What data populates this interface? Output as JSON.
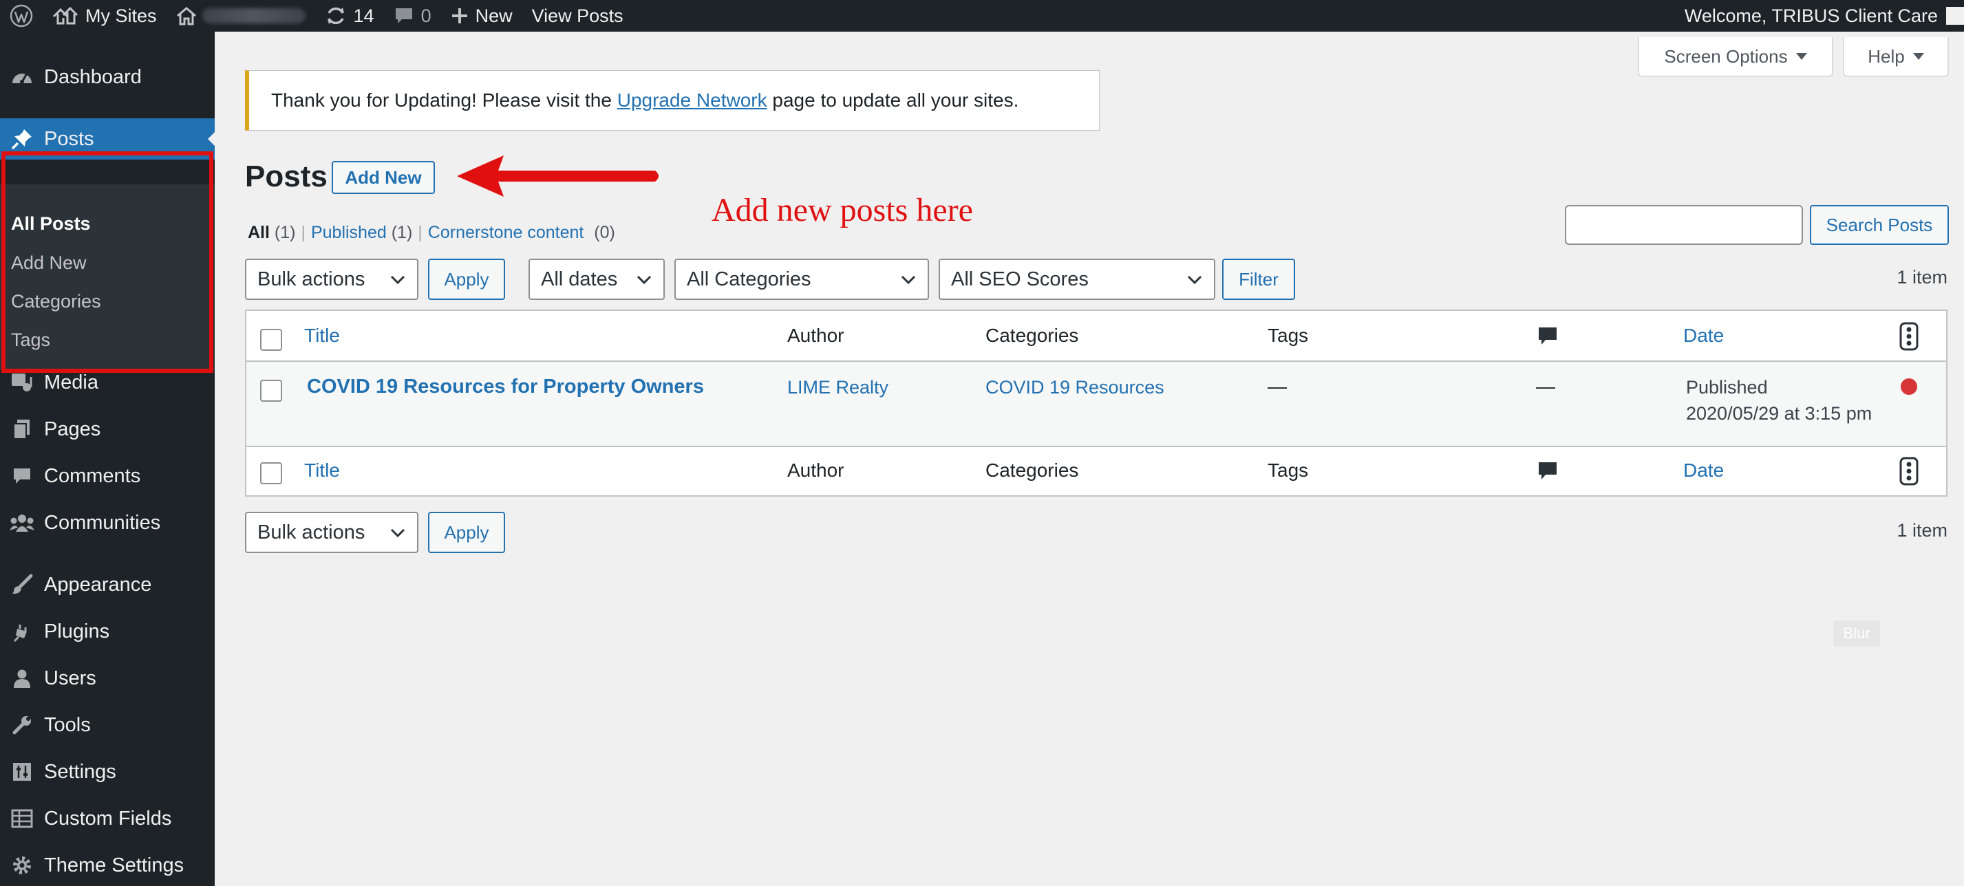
{
  "admin_bar": {
    "wp_logo": "wordpress-icon",
    "my_sites": "My Sites",
    "updates_count": "14",
    "comments_count": "0",
    "new_label": "New",
    "view_posts": "View Posts",
    "welcome": "Welcome, TRIBUS Client Care"
  },
  "sidebar": {
    "dashboard": "Dashboard",
    "posts": "Posts",
    "submenu": [
      "All Posts",
      "Add New",
      "Categories",
      "Tags"
    ],
    "media": "Media",
    "pages": "Pages",
    "comments": "Comments",
    "communities": "Communities",
    "appearance": "Appearance",
    "plugins": "Plugins",
    "users": "Users",
    "tools": "Tools",
    "settings": "Settings",
    "custom_fields": "Custom Fields",
    "theme_settings": "Theme Settings"
  },
  "screen_options": "Screen Options",
  "help": "Help",
  "notice": {
    "before": "Thank you for Updating! Please visit the ",
    "link": "Upgrade Network",
    "after": " page to update all your sites."
  },
  "page_title": "Posts",
  "add_new": "Add New",
  "annotation": "Add new posts here",
  "views": {
    "all": "All",
    "all_count": "(1)",
    "published": "Published",
    "published_count": "(1)",
    "cornerstone": "Cornerstone content",
    "cornerstone_count": "(0)"
  },
  "search": {
    "button": "Search Posts",
    "value": ""
  },
  "filters": {
    "bulk_actions": "Bulk actions",
    "apply": "Apply",
    "dates": "All dates",
    "categories": "All Categories",
    "seo_scores": "All SEO Scores",
    "filter": "Filter"
  },
  "items_count": "1 item",
  "table": {
    "columns": {
      "title": "Title",
      "author": "Author",
      "categories": "Categories",
      "tags": "Tags",
      "date": "Date"
    },
    "rows": [
      {
        "title": "COVID 19 Resources for Property Owners",
        "author": "LIME Realty",
        "categories": "COVID 19 Resources",
        "tags": "—",
        "comments": "—",
        "status": "Published",
        "date": "2020/05/29 at 3:15 pm",
        "seo_color": "#d63638"
      }
    ]
  },
  "blur_label": "Blur"
}
